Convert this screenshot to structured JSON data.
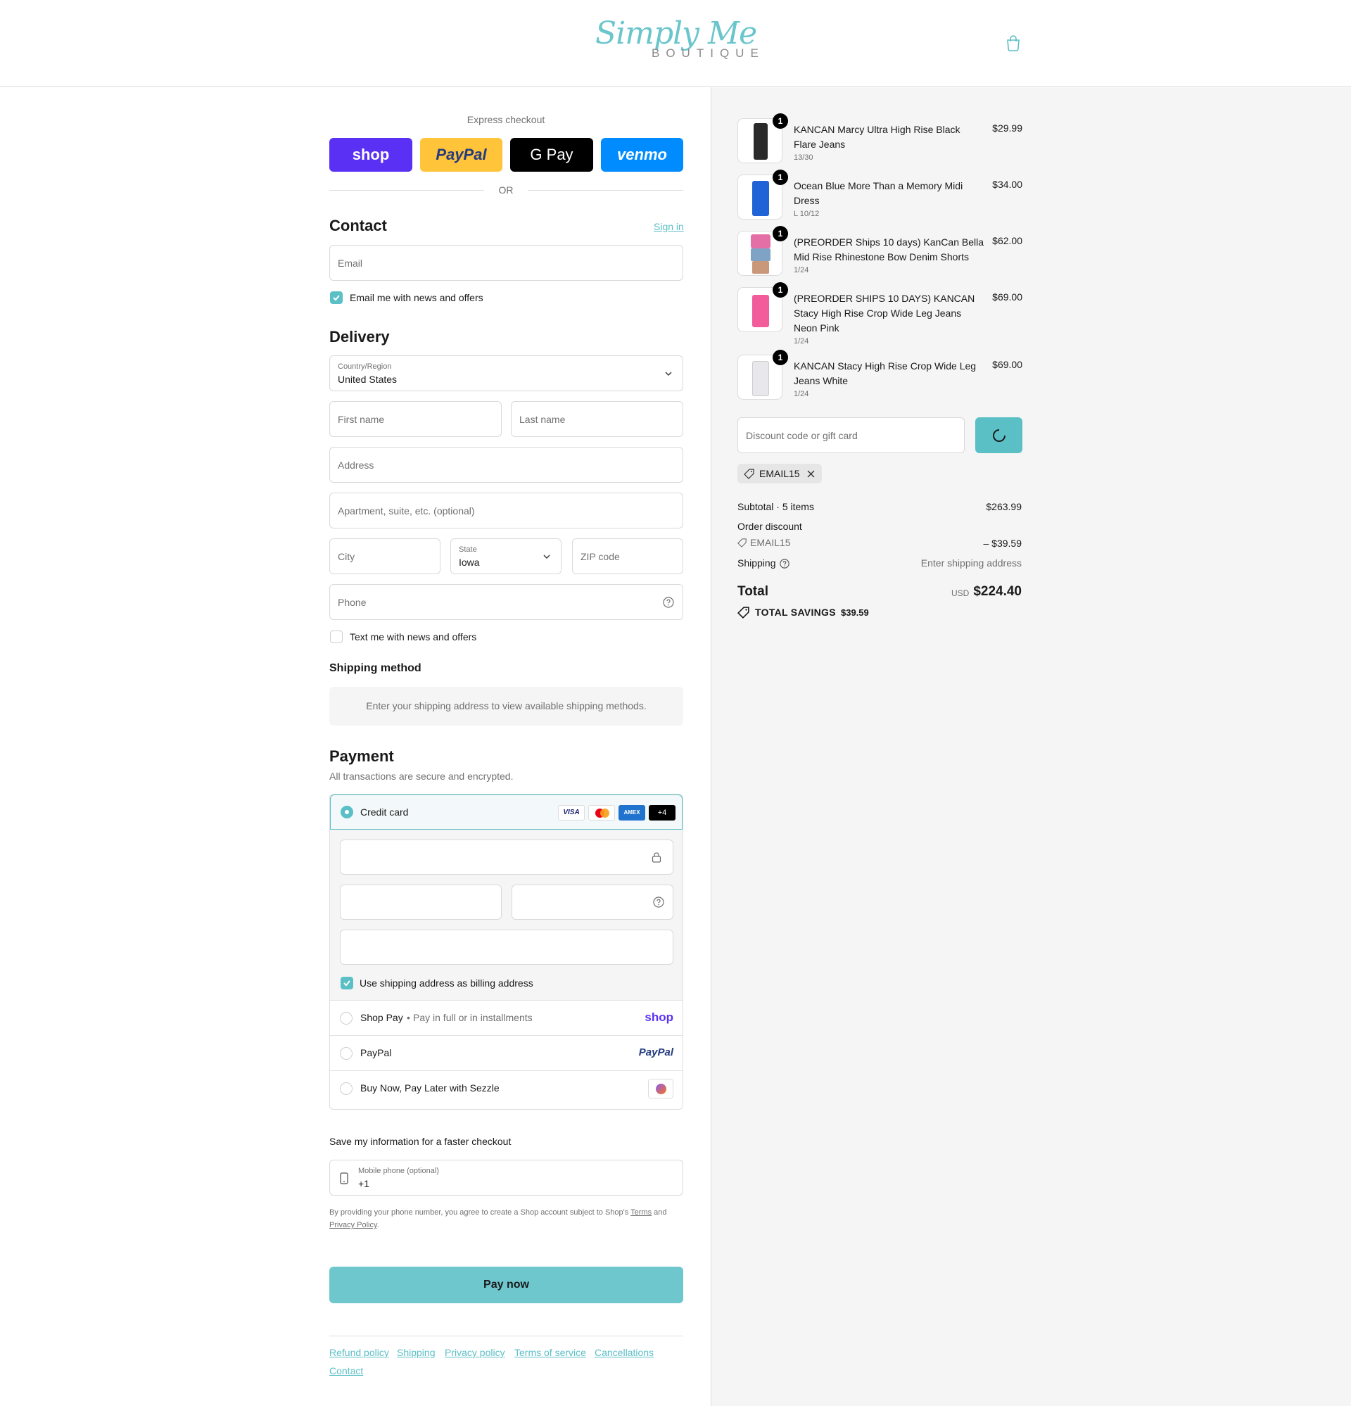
{
  "header": {
    "logo_script": "Simply Me",
    "logo_sub": "BOUTIQUE",
    "cart_icon": "shopping-bag-icon"
  },
  "express": {
    "title": "Express checkout",
    "buttons": [
      {
        "label": "shop",
        "bg": "#5a31f4",
        "color": "#ffffff"
      },
      {
        "label": "PayPal",
        "bg": "#ffc439",
        "color": "#253b80"
      },
      {
        "label": "G Pay",
        "bg": "#000000",
        "color": "#ffffff"
      },
      {
        "label": "venmo",
        "bg": "#008cff",
        "color": "#ffffff"
      }
    ],
    "or": "OR"
  },
  "contact": {
    "title": "Contact",
    "sign_in": "Sign in",
    "email_placeholder": "Email",
    "news_label": "Email me with news and offers"
  },
  "delivery": {
    "title": "Delivery",
    "country_label": "Country/Region",
    "country_value": "United States",
    "first_name": "First name",
    "last_name": "Last name",
    "address": "Address",
    "apartment": "Apartment, suite, etc. (optional)",
    "city": "City",
    "state_label": "State",
    "state_value": "Iowa",
    "zip": "ZIP code",
    "phone": "Phone",
    "text_label": "Text me with news and offers"
  },
  "shipping_method": {
    "title": "Shipping method",
    "message": "Enter your shipping address to view available shipping methods."
  },
  "payment": {
    "title": "Payment",
    "subtitle": "All transactions are secure and encrypted.",
    "credit_card": "Credit card",
    "card_logos": [
      "VISA",
      "",
      "AMEX",
      "+4"
    ],
    "billing_label": "Use shipping address as billing address",
    "shop_pay": "Shop Pay",
    "shop_pay_sub": "Pay in full or in installments",
    "shop_pay_logo": "shop",
    "paypal": "PayPal",
    "paypal_logo": "PayPal",
    "sezzle": "Buy Now, Pay Later with Sezzle"
  },
  "save_info": {
    "title": "Save my information for a faster checkout",
    "phone_label": "Mobile phone (optional)",
    "phone_value": "+1",
    "legal_prefix": "By providing your phone number, you agree to create a Shop account subject to Shop's",
    "terms": "Terms",
    "and": "and",
    "privacy": "Privacy Policy",
    "period": "."
  },
  "pay_now": "Pay now",
  "footer": {
    "links": [
      "Refund policy",
      "Shipping",
      "Privacy policy",
      "Terms of service",
      "Cancellations",
      "Contact"
    ]
  },
  "order": {
    "items": [
      {
        "qty": "1",
        "name": "KANCAN Marcy Ultra High Rise Black Flare Jeans",
        "variant": "13/30",
        "price": "$29.99",
        "img": "#2a2a2a"
      },
      {
        "qty": "1",
        "name": "Ocean Blue More Than a Memory Midi Dress",
        "variant": "L 10/12",
        "price": "$34.00",
        "img": "#1f63d6"
      },
      {
        "qty": "1",
        "name": "(PREORDER Ships 10 days) KanCan Bella Mid Rise Rhinestone Bow Denim Shorts",
        "variant": "1/24",
        "price": "$62.00",
        "img": "#7fa3c4"
      },
      {
        "qty": "1",
        "name": "(PREORDER SHIPS 10 DAYS) KANCAN Stacy High Rise Crop Wide Leg Jeans Neon Pink",
        "variant": "1/24",
        "price": "$69.00",
        "img": "#f25c9a"
      },
      {
        "qty": "1",
        "name": "KANCAN Stacy High Rise Crop Wide Leg Jeans White",
        "variant": "1/24",
        "price": "$69.00",
        "img": "#e8e8ec"
      }
    ],
    "discount_placeholder": "Discount code or gift card",
    "applied_code": "EMAIL15",
    "subtotal_label": "Subtotal · 5 items",
    "subtotal_value": "$263.99",
    "order_discount_label": "Order discount",
    "discount_code": "EMAIL15",
    "discount_value": "– $39.59",
    "shipping_label": "Shipping",
    "shipping_value": "Enter shipping address",
    "total_label": "Total",
    "currency": "USD",
    "total_value": "$224.40",
    "savings_label": "TOTAL SAVINGS",
    "savings_value": "$39.59"
  },
  "colors": {
    "accent": "#5bbfc6",
    "pay_button": "#6fc7ce",
    "summary_bg": "#f5f5f5"
  }
}
